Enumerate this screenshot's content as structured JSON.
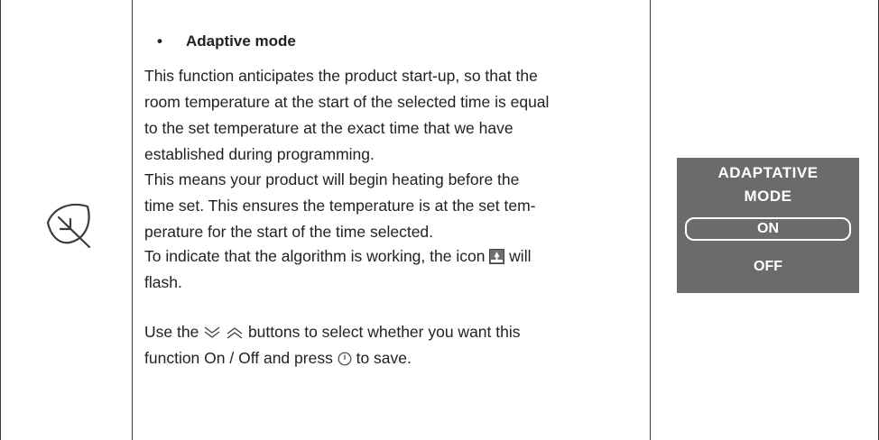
{
  "section": {
    "bullet": "•",
    "heading": "Adaptive mode",
    "icon": "leaf-icon"
  },
  "body": {
    "paragraph1": [
      "This function anticipates the product start-up, so that the",
      "room temperature at the start of the selected time is equal",
      "to the set temperature at the exact time that we have",
      "established during programming."
    ],
    "paragraph2": [
      "This means your product will begin heating before the",
      "time set. This ensures the temperature is at the set tem-",
      "perature for the start of the time selected."
    ],
    "paragraph3": {
      "line1_before_icon": "To indicate that the algorithm is working, the icon",
      "line1_after_icon": "will",
      "line2": "flash.",
      "inline_icon": "adaptive-algorithm-icon"
    },
    "paragraph4": {
      "line1_before_buttons": "Use the",
      "line1_after_buttons": "buttons to select whether you want this",
      "line2_before_icon": "function On / Off and press",
      "line2_after_icon": "to save.",
      "down_icon": "double-chevron-down-icon",
      "up_icon": "double-chevron-up-icon",
      "confirm_icon": "power-button-icon"
    }
  },
  "display": {
    "title_line1": "ADAPTATIVE",
    "title_line2": "MODE",
    "options": [
      "ON",
      "OFF"
    ],
    "selected": "ON",
    "background_color": "#6b6b6b",
    "text_color": "#ffffff"
  }
}
